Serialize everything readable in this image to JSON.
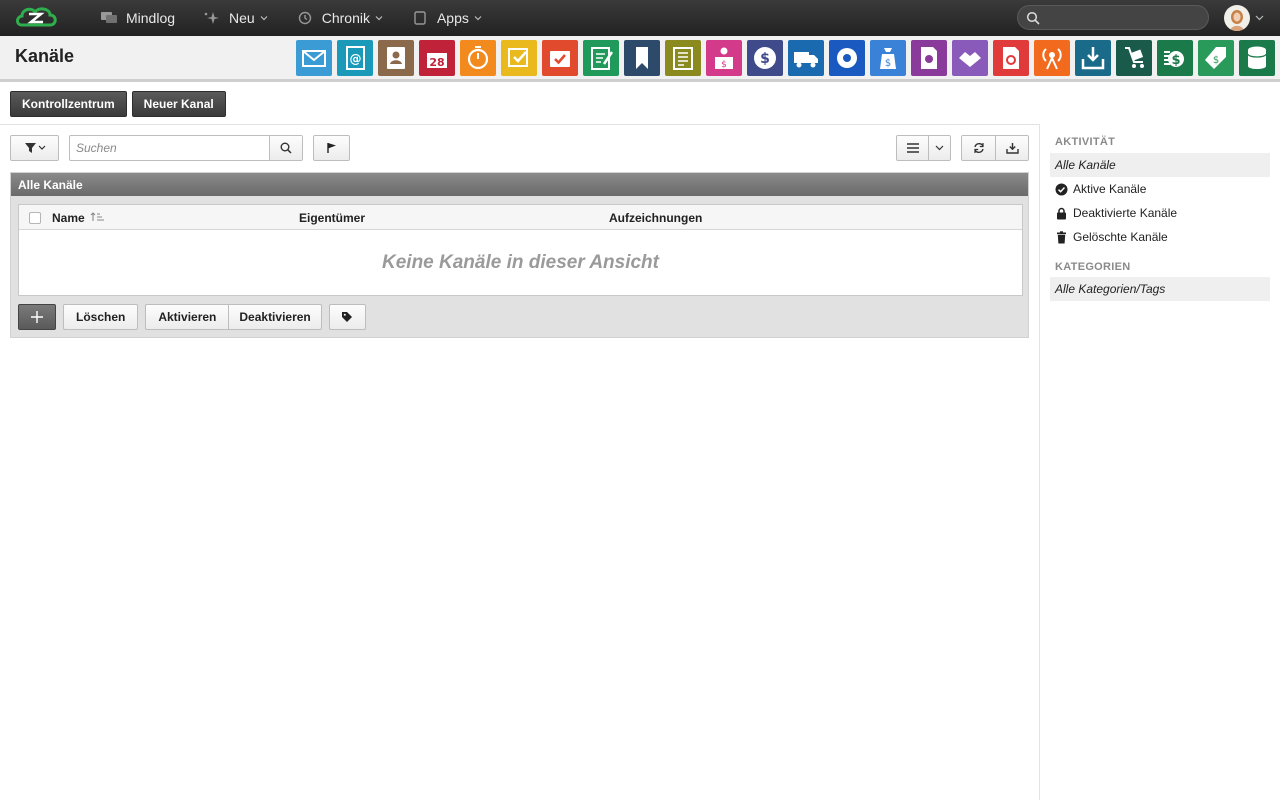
{
  "topnav": {
    "items": [
      {
        "label": "Mindlog",
        "icon": "chat-icon",
        "has_menu": false
      },
      {
        "label": "Neu",
        "icon": "sparkle-icon",
        "has_menu": true
      },
      {
        "label": "Chronik",
        "icon": "history-icon",
        "has_menu": true
      },
      {
        "label": "Apps",
        "icon": "tablet-icon",
        "has_menu": true
      }
    ],
    "search_placeholder": ""
  },
  "header": {
    "title": "Kanäle",
    "app_icons": [
      {
        "name": "mail-app-icon",
        "color": "#3a9bd5"
      },
      {
        "name": "address-book-app-icon",
        "color": "#1a9ab8",
        "label": "@"
      },
      {
        "name": "contacts-app-icon",
        "color": "#8a6a4a"
      },
      {
        "name": "calendar-app-icon",
        "color": "#c0223a",
        "label": "28"
      },
      {
        "name": "timer-app-icon",
        "color": "#f28a1e"
      },
      {
        "name": "tasks-app-icon",
        "color": "#e9b91e"
      },
      {
        "name": "projects-app-icon",
        "color": "#e14a2c"
      },
      {
        "name": "notes-app-icon",
        "color": "#1f9a5a"
      },
      {
        "name": "bookmarks-app-icon",
        "color": "#2e4a6a"
      },
      {
        "name": "documents-app-icon",
        "color": "#8a8a1e"
      },
      {
        "name": "helpdesk-app-icon",
        "color": "#d43a8a"
      },
      {
        "name": "finance-app-icon",
        "color": "#3e4a8a"
      },
      {
        "name": "shipping-app-icon",
        "color": "#1a6ab0"
      },
      {
        "name": "support-app-icon",
        "color": "#1a5ac0"
      },
      {
        "name": "budget-app-icon",
        "color": "#3a82d8"
      },
      {
        "name": "legal-app-icon",
        "color": "#8a3a9a"
      },
      {
        "name": "deals-app-icon",
        "color": "#8a5aba"
      },
      {
        "name": "pdf-app-icon",
        "color": "#e03a3a"
      },
      {
        "name": "broadcast-app-icon",
        "color": "#f26a1e"
      },
      {
        "name": "downloads-app-icon",
        "color": "#1a6a8a"
      },
      {
        "name": "logistics-app-icon",
        "color": "#1a5a4a"
      },
      {
        "name": "payments-app-icon",
        "color": "#1a7a4a"
      },
      {
        "name": "pricing-app-icon",
        "color": "#2a9a5a"
      },
      {
        "name": "database-app-icon",
        "color": "#1a7a4a"
      }
    ]
  },
  "actions": {
    "control_center": "Kontrollzentrum",
    "new_channel": "Neuer Kanal"
  },
  "toolbar": {
    "search_placeholder": "Suchen"
  },
  "panel": {
    "title": "Alle Kanäle",
    "columns": [
      "Name",
      "Eigentümer",
      "Aufzeichnungen"
    ],
    "empty_message": "Keine Kanäle in dieser Ansicht",
    "buttons": {
      "delete": "Löschen",
      "activate": "Aktivieren",
      "deactivate": "Deaktivieren"
    }
  },
  "sidebar": {
    "activity_heading": "AKTIVITÄT",
    "activity_items": [
      {
        "label": "Alle Kanäle",
        "icon": "",
        "selected": true
      },
      {
        "label": "Aktive Kanäle",
        "icon": "check-circle-icon",
        "selected": false
      },
      {
        "label": "Deaktivierte Kanäle",
        "icon": "lock-icon",
        "selected": false
      },
      {
        "label": "Gelöschte Kanäle",
        "icon": "trash-icon",
        "selected": false
      }
    ],
    "categories_heading": "KATEGORIEN",
    "category_items": [
      {
        "label": "Alle Kategorien/Tags",
        "selected": true
      }
    ]
  }
}
